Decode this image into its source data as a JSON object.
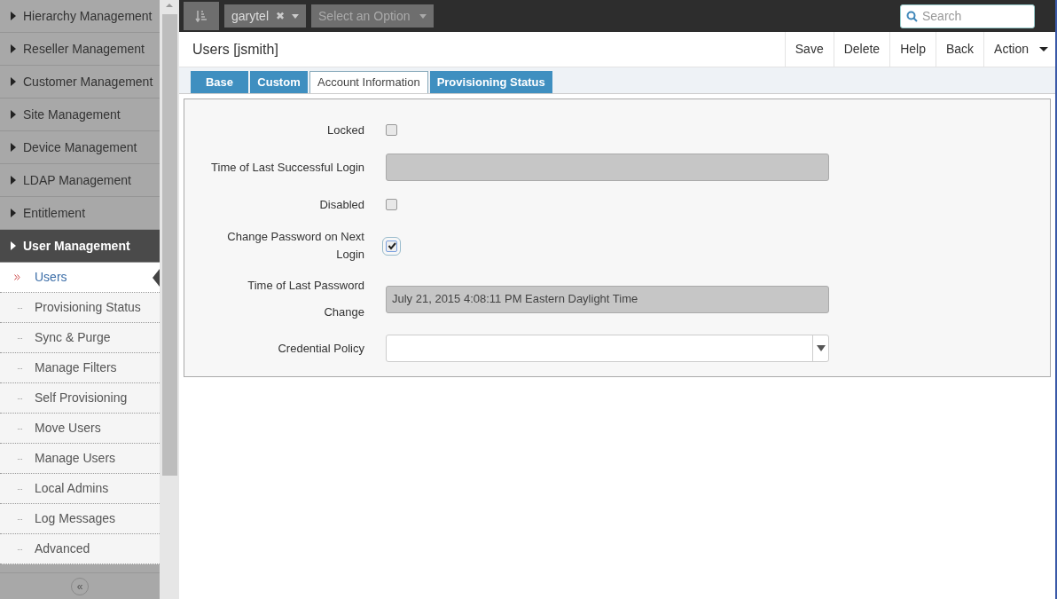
{
  "sidebar": {
    "groups": [
      {
        "label": "Hierarchy Management",
        "expanded": false
      },
      {
        "label": "Reseller Management",
        "expanded": false
      },
      {
        "label": "Customer Management",
        "expanded": false
      },
      {
        "label": "Site Management",
        "expanded": false
      },
      {
        "label": "Device Management",
        "expanded": false
      },
      {
        "label": "LDAP Management",
        "expanded": false
      },
      {
        "label": "Entitlement",
        "expanded": false
      },
      {
        "label": "User Management",
        "expanded": true,
        "children": [
          {
            "label": "Users",
            "selected": true
          },
          {
            "label": "Provisioning Status",
            "selected": false
          },
          {
            "label": "Sync & Purge",
            "selected": false
          },
          {
            "label": "Manage Filters",
            "selected": false
          },
          {
            "label": "Self Provisioning",
            "selected": false
          },
          {
            "label": "Move Users",
            "selected": false
          },
          {
            "label": "Manage Users",
            "selected": false
          },
          {
            "label": "Local Admins",
            "selected": false
          },
          {
            "label": "Log Messages",
            "selected": false
          },
          {
            "label": "Advanced",
            "selected": false
          }
        ]
      }
    ],
    "collapse_button": "«"
  },
  "toolbar": {
    "hierarchy_chip": "garytel",
    "hierarchy_clear": "✖",
    "option_select": {
      "placeholder": "Select an Option"
    },
    "search": {
      "placeholder": "Search"
    }
  },
  "page": {
    "title": "Users [jsmith]",
    "actions": [
      "Save",
      "Delete",
      "Help",
      "Back",
      "Action"
    ]
  },
  "tabs": [
    {
      "label": "Base",
      "selected": false
    },
    {
      "label": "Custom",
      "selected": false
    },
    {
      "label": "Account Information",
      "selected": true
    },
    {
      "label": "Provisioning Status",
      "selected": false
    }
  ],
  "fields": [
    {
      "kind": "checkbox",
      "label": "Locked",
      "checked": false
    },
    {
      "kind": "readonly",
      "label": "Time of Last Successful Login"
    },
    {
      "kind": "checkbox",
      "label": "Disabled",
      "checked": false
    },
    {
      "kind": "checkbox",
      "label": "Change Password on Next Login",
      "checked": true
    },
    {
      "kind": "readonly",
      "label": "Time of Last Password Change",
      "value": "July 21, 2015 4:08:11 PM Eastern Daylight Time"
    },
    {
      "kind": "select",
      "label": "Credential Policy"
    }
  ]
}
